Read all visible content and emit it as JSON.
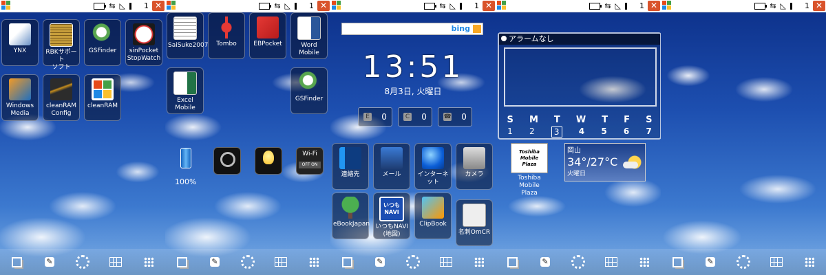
{
  "statusbar": {
    "signal": "1",
    "close": "✕"
  },
  "panel1": {
    "apps": [
      {
        "label": "YNX"
      },
      {
        "label": "RBKサポート\nソフト"
      },
      {
        "label": "GSFinder"
      },
      {
        "label": "sinPocket\nStopWatch"
      },
      {
        "label": "Windows\nMedia"
      },
      {
        "label": "cleanRAM\nConfig"
      },
      {
        "label": "cleanRAM"
      }
    ]
  },
  "panel2": {
    "apps": [
      {
        "label": "SaiSuke2007"
      },
      {
        "label": "Tombo"
      },
      {
        "label": "EBPocket"
      },
      {
        "label": "Word Mobile"
      },
      {
        "label": "Excel Mobile"
      },
      {
        "label": "GSFinder"
      }
    ],
    "battery_percent": "100%",
    "wifi_label": "Wi-Fi",
    "wifi_switch": "OFF ON"
  },
  "panel3": {
    "search_brand": "bing",
    "clock": "13:51",
    "date": "8月3日, 火曜日",
    "counters": [
      {
        "key": "E",
        "value": "0"
      },
      {
        "key": "C",
        "value": "0"
      },
      {
        "key": "☎",
        "value": "0"
      }
    ],
    "apps": [
      {
        "label": "連絡先"
      },
      {
        "label": "メール"
      },
      {
        "label": "インターネット"
      },
      {
        "label": "カメラ"
      },
      {
        "label": "eBookJapan"
      },
      {
        "label": "いつもNAVI\n(地図)"
      },
      {
        "label": "ClipBook"
      },
      {
        "label": "名刺OmCR"
      }
    ],
    "navi_icon_text": "いつも\nNAVI"
  },
  "panel4": {
    "alarm_title": "アラームなし",
    "weekdays": [
      "S",
      "M",
      "T",
      "W",
      "T",
      "F",
      "S"
    ],
    "days": [
      "1",
      "2",
      "3",
      "4",
      "5",
      "6",
      "7"
    ],
    "today": "3",
    "toshiba_logo": "Toshiba\nMobile\nPlaza",
    "toshiba_label": "Toshiba\nMobile Plaza",
    "weather": {
      "city": "岡山",
      "temp": "34°/27°C",
      "day": "火曜日"
    }
  },
  "colors": {
    "sky_top": "#0c2f88",
    "sky_bottom": "#7fb0e6",
    "close_red": "#d9532b"
  }
}
